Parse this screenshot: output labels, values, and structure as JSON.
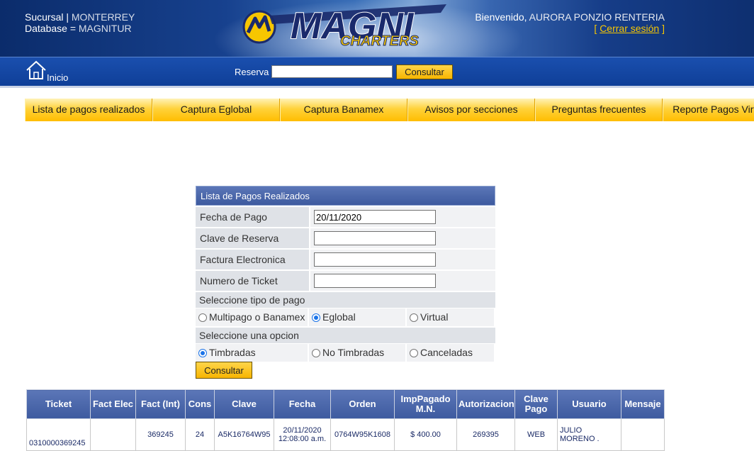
{
  "header": {
    "sucursal_label": "Sucursal |",
    "sucursal_value": "MONTERREY",
    "database_label": "Database =",
    "database_value": "MAGNITUR",
    "logo_main": "MAGNI",
    "logo_sub": "CHARTERS",
    "welcome_label": "Bienvenido,",
    "user_name": "AURORA PONZIO RENTERIA",
    "logout_open": "[",
    "logout_label": "Cerrar sesión",
    "logout_close": "]"
  },
  "bar": {
    "home_label": "Inicio",
    "reserva_label": "Reserva",
    "reserva_value": "",
    "consultar_label": "Consultar"
  },
  "nav": {
    "items": [
      "Lista de pagos realizados",
      "Captura Eglobal",
      "Captura Banamex",
      "Avisos por secciones",
      "Preguntas frecuentes",
      "Reporte Pagos Virtuales"
    ]
  },
  "form": {
    "title": "Lista de Pagos Realizados",
    "fecha_label": "Fecha de Pago",
    "fecha_value": "20/11/2020",
    "clave_label": "Clave de Reserva",
    "clave_value": "",
    "factura_label": "Factura Electronica",
    "factura_value": "",
    "ticket_label": "Numero de Ticket",
    "ticket_value": "",
    "tipo_label": "Seleccione tipo de pago",
    "tipo_options": [
      "Multipago o Banamex",
      "Eglobal",
      "Virtual"
    ],
    "tipo_selected": "Eglobal",
    "opcion_label": "Seleccione una opcion",
    "opcion_options": [
      "Timbradas",
      "No Timbradas",
      "Canceladas"
    ],
    "opcion_selected": "Timbradas",
    "submit_label": "Consultar"
  },
  "table": {
    "headers": [
      "Ticket",
      "Fact Elec",
      "Fact (Int)",
      "Cons",
      "Clave",
      "Fecha",
      "Orden",
      "ImpPagado M.N.",
      "Autorizacion",
      "Clave Pago",
      "Usuario",
      "Mensaje"
    ],
    "rows": [
      {
        "ticket": "0310000369245",
        "fact_elec": "",
        "fact_int": "369245",
        "cons": "24",
        "clave": "A5K16764W95",
        "fecha": "20/11/2020 12:08:00 a.m.",
        "orden": "0764W95K1608",
        "importe": "$ 400.00",
        "autorizacion": "269395",
        "clave_pago": "WEB",
        "usuario": "JULIO MORENO .",
        "mensaje": ""
      }
    ]
  },
  "colors": {
    "accent_yellow": "#ffc20e",
    "header_blue": "#0f3f98",
    "table_header": "#4a66aa"
  }
}
